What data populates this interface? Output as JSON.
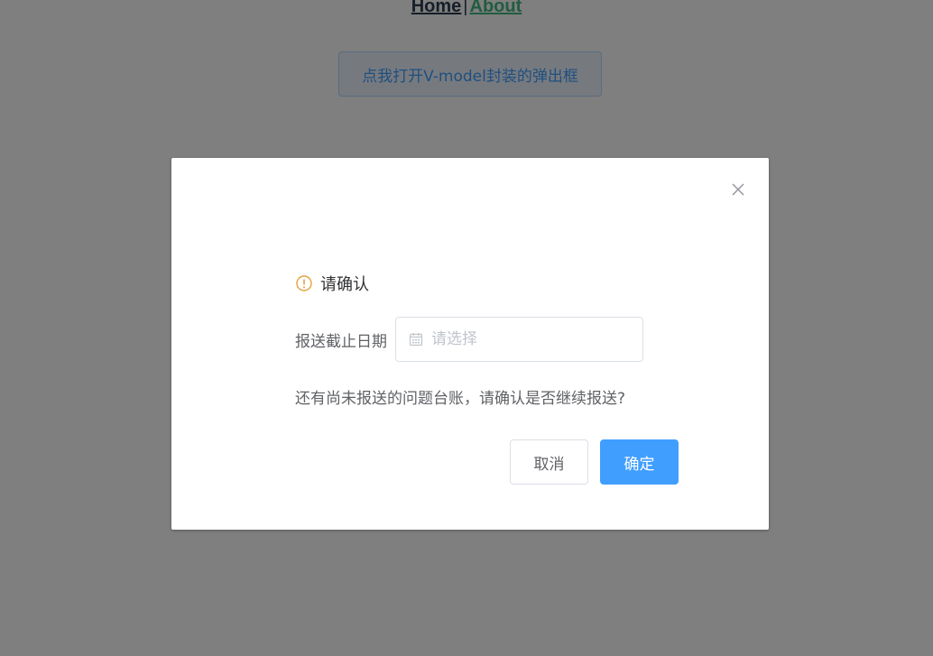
{
  "nav": {
    "home": "Home",
    "separator": "|",
    "about": "About"
  },
  "open_button": "点我打开V-model封装的弹出框",
  "dialog": {
    "title": "请确认",
    "date_label": "报送截止日期",
    "date_placeholder": "请选择",
    "date_value": "",
    "message": "还有尚未报送的问题台账，请确认是否继续报送?",
    "cancel_label": "取消",
    "confirm_label": "确定"
  },
  "colors": {
    "primary": "#409eff",
    "warning": "#e6a23c",
    "link_active": "#42b983",
    "text_dark": "#2c3e50",
    "overlay": "rgba(0,0,0,0.5)"
  },
  "icons": {
    "close": "close-icon",
    "warning": "warning-icon",
    "calendar": "calendar-icon"
  }
}
